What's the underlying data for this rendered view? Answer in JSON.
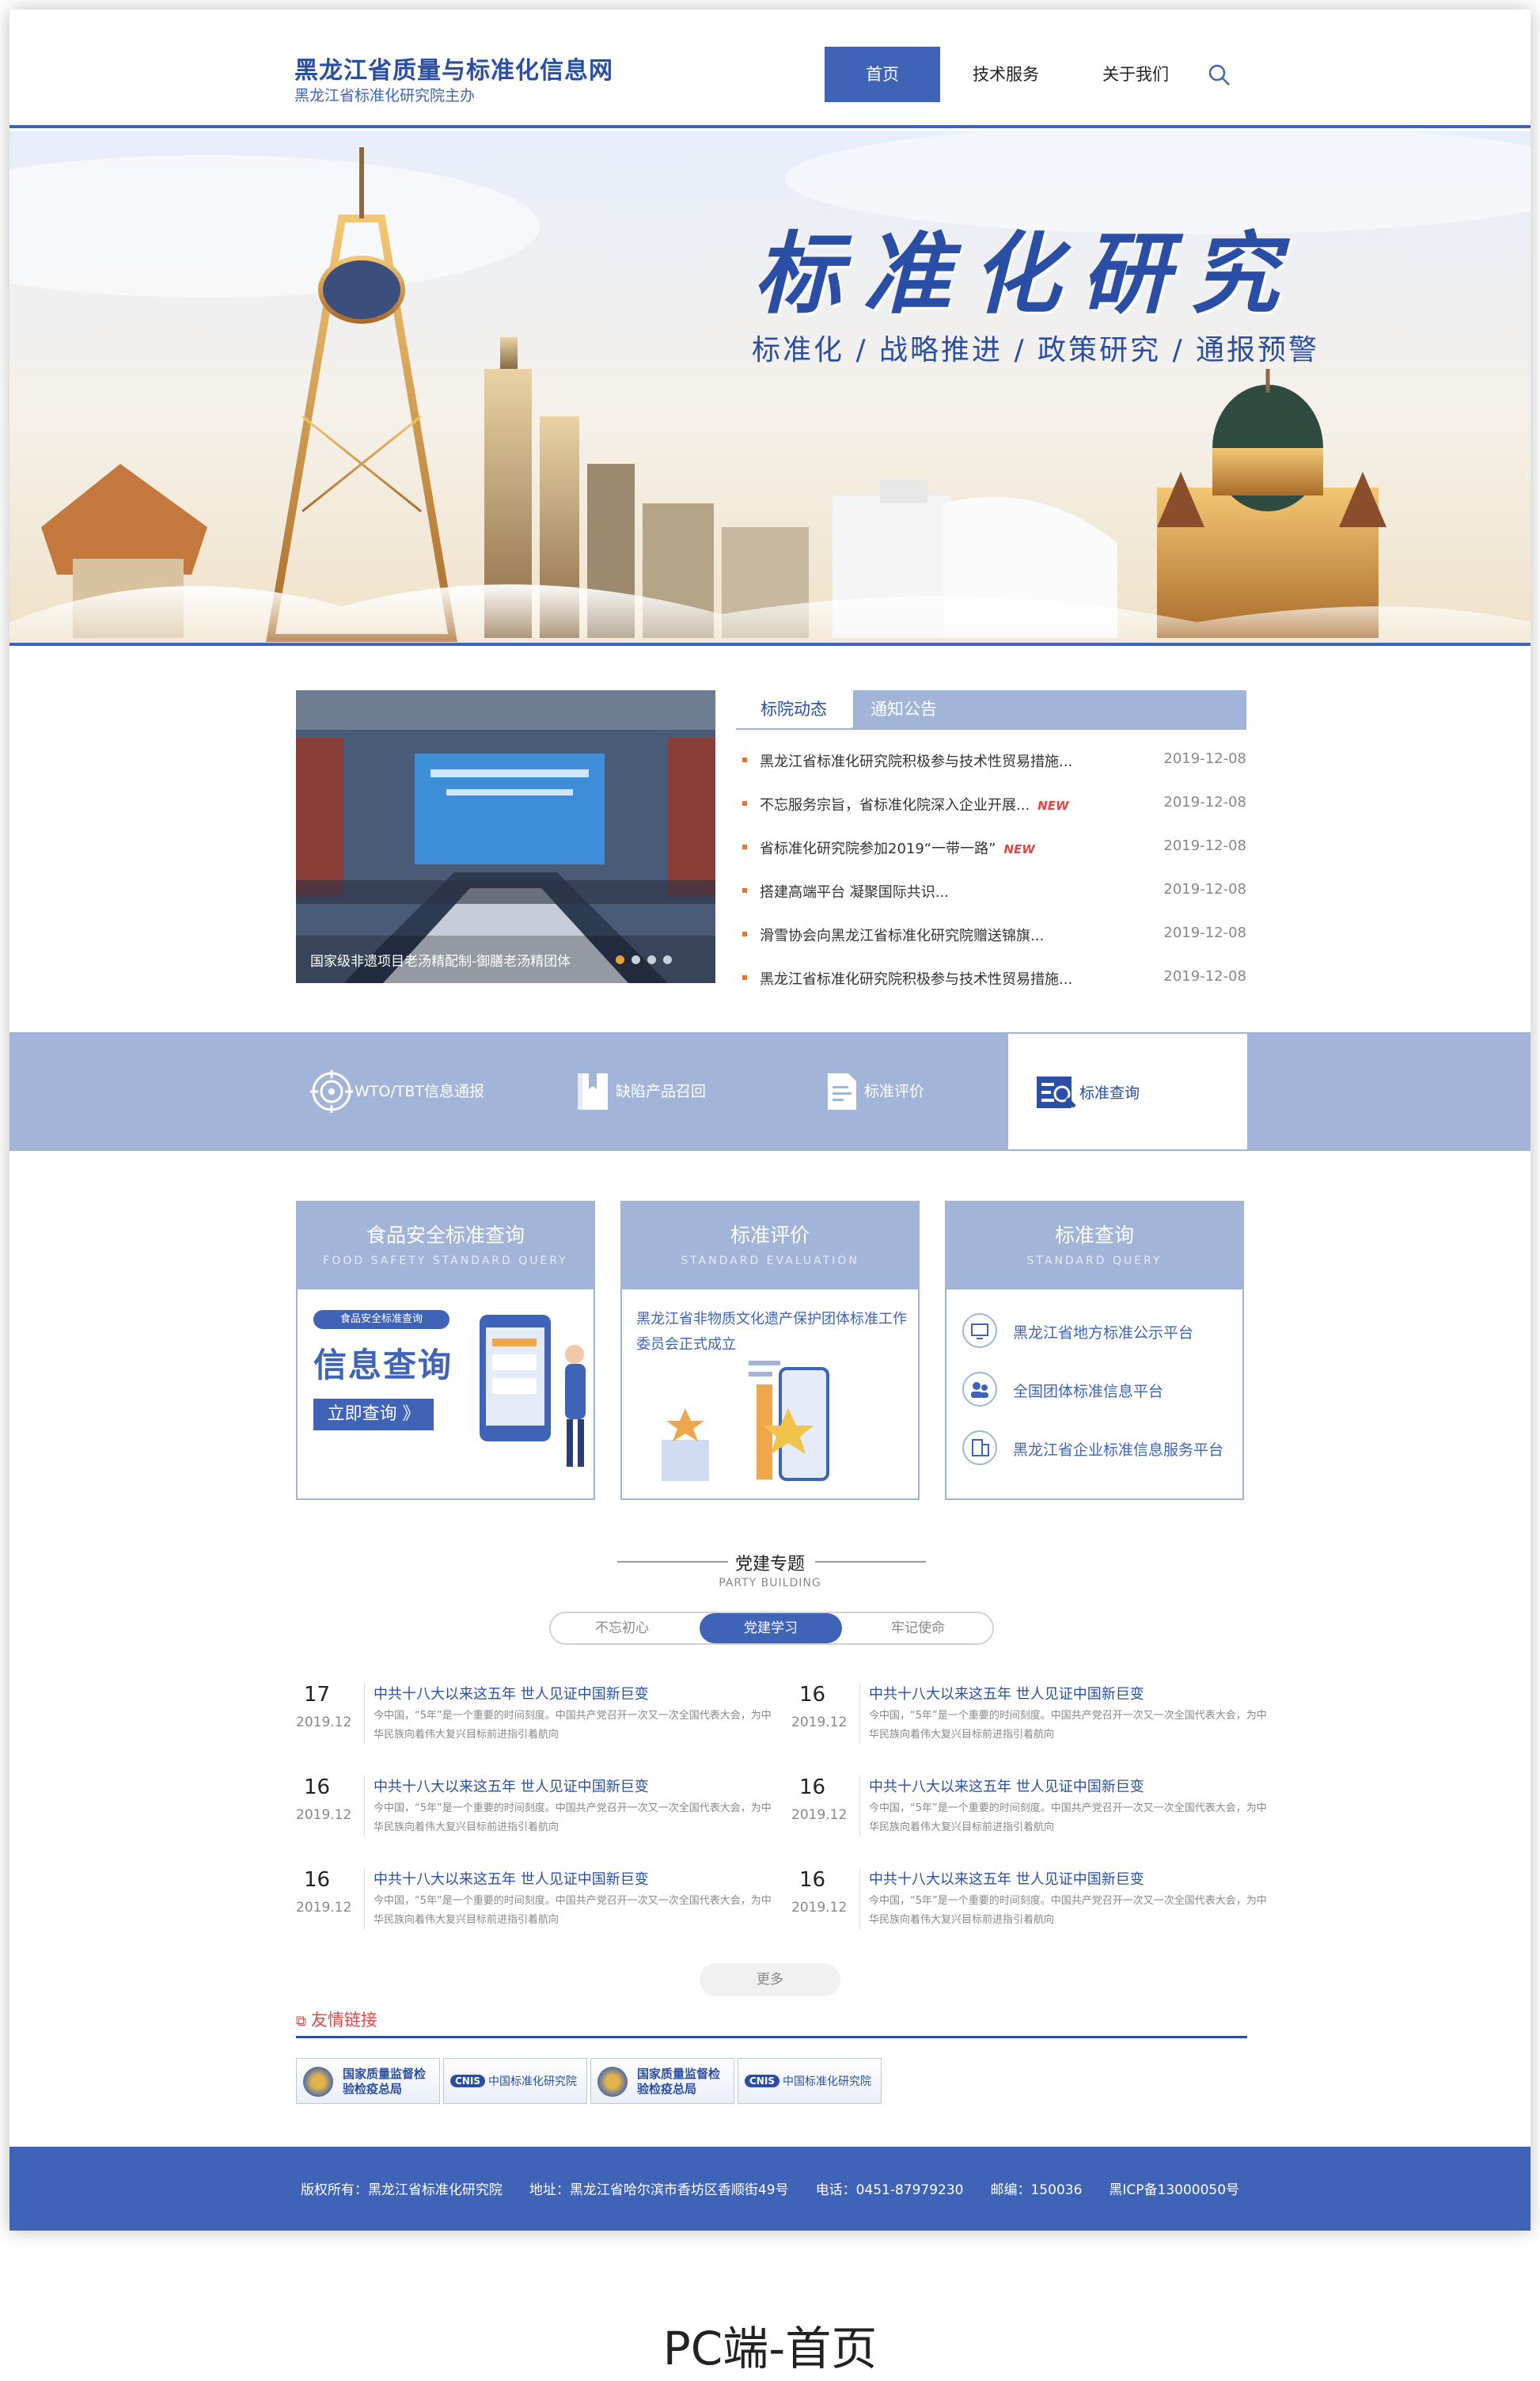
{
  "header": {
    "site_title": "黑龙江省质量与标准化信息网",
    "site_subtitle": "黑龙江省标准化研究院主办",
    "nav": [
      "首页",
      "技术服务",
      "关于我们"
    ],
    "search_icon": "search-icon"
  },
  "banner": {
    "title": "标准化研究",
    "subtitle": "标准化 / 战略推进 / 政策研究 / 通报预警"
  },
  "news": {
    "image_caption": "国家级非遗项目老汤精配制-御膳老汤精团体",
    "tabs": [
      "标院动态",
      "通知公告"
    ],
    "new_badge": "NEW",
    "items": [
      {
        "title": "黑龙江省标准化研究院积极参与技术性贸易措施...",
        "date": "2019-12-08",
        "is_new": false
      },
      {
        "title": "不忘服务宗旨，省标准化院深入企业开展...",
        "date": "2019-12-08",
        "is_new": true
      },
      {
        "title": "省标准化研究院参加2019“一带一路”",
        "date": "2019-12-08",
        "is_new": true
      },
      {
        "title": "搭建高端平台 凝聚国际共识...",
        "date": "2019-12-08",
        "is_new": false
      },
      {
        "title": "滑雪协会向黑龙江省标准化研究院赠送锦旗...",
        "date": "2019-12-08",
        "is_new": false
      },
      {
        "title": "黑龙江省标准化研究院积极参与技术性贸易措施...",
        "date": "2019-12-08",
        "is_new": false
      }
    ]
  },
  "services": [
    {
      "label": "WTO/TBT信息通报",
      "icon": "target-icon"
    },
    {
      "label": "缺陷产品召回",
      "icon": "bookmark-book-icon"
    },
    {
      "label": "标准评价",
      "icon": "document-edit-icon"
    },
    {
      "label": "标准查询",
      "icon": "document-search-icon"
    }
  ],
  "cards": {
    "food": {
      "title": "食品安全标准查询",
      "subtitle": "FOOD SAFETY STANDARD QUERY",
      "tag": "食品安全标准查询",
      "big_text": "信息查询",
      "button": "立即查询 》"
    },
    "evaluation": {
      "title": "标准评价",
      "subtitle": "STANDARD EVALUATION",
      "text": "黑龙江省非物质文化遗产保护团体标准工作委员会正式成立"
    },
    "query": {
      "title": "标准查询",
      "subtitle": "STANDARD QUERY",
      "platforms": [
        "黑龙江省地方标准公示平台",
        "全国团体标准信息平台",
        "黑龙江省企业标准信息服务平台"
      ]
    }
  },
  "party": {
    "title": "党建专题",
    "subtitle": "PARTY BUILDING",
    "tabs": [
      "不忘初心",
      "党建学习",
      "牢记使命"
    ],
    "items": [
      {
        "day": "17",
        "month": "2019.12",
        "title": "中共十八大以来这五年 世人见证中国新巨变",
        "desc": "今中国，“5年”是一个重要的时间刻度。中国共产党召开一次又一次全国代表大会，为中华民族向着伟大复兴目标前进指引着航向"
      },
      {
        "day": "16",
        "month": "2019.12",
        "title": "中共十八大以来这五年 世人见证中国新巨变",
        "desc": "今中国，“5年”是一个重要的时间刻度。中国共产党召开一次又一次全国代表大会，为中华民族向着伟大复兴目标前进指引着航向"
      },
      {
        "day": "16",
        "month": "2019.12",
        "title": "中共十八大以来这五年 世人见证中国新巨变",
        "desc": "今中国，“5年”是一个重要的时间刻度。中国共产党召开一次又一次全国代表大会，为中华民族向着伟大复兴目标前进指引着航向"
      },
      {
        "day": "16",
        "month": "2019.12",
        "title": "中共十八大以来这五年 世人见证中国新巨变",
        "desc": "今中国，“5年”是一个重要的时间刻度。中国共产党召开一次又一次全国代表大会，为中华民族向着伟大复兴目标前进指引着航向"
      },
      {
        "day": "16",
        "month": "2019.12",
        "title": "中共十八大以来这五年 世人见证中国新巨变",
        "desc": "今中国，“5年”是一个重要的时间刻度。中国共产党召开一次又一次全国代表大会，为中华民族向着伟大复兴目标前进指引着航向"
      },
      {
        "day": "16",
        "month": "2019.12",
        "title": "中共十八大以来这五年 世人见证中国新巨变",
        "desc": "今中国，“5年”是一个重要的时间刻度。中国共产党召开一次又一次全国代表大会，为中华民族向着伟大复兴目标前进指引着航向"
      }
    ],
    "more": "更多"
  },
  "links": {
    "title": "友情链接",
    "logos": [
      {
        "text": "国家质量监督检验检疫总局",
        "type": "emblem"
      },
      {
        "text": "中国标准化研究院",
        "type": "cnis"
      },
      {
        "text": "国家质量监督检验检疫总局",
        "type": "emblem"
      },
      {
        "text": "中国标准化研究院",
        "type": "cnis"
      }
    ]
  },
  "footer": {
    "text": "版权所有：黑龙江省标准化研究院　　地址：黑龙江省哈尔滨市香坊区香顺街49号　　电话：0451-87979230　　邮编：150036　　黑ICP备13000050号"
  },
  "caption": "PC端-首页",
  "colors": {
    "primary": "#3f63b6",
    "light": "#a3b4d9",
    "accent": "#e8742c",
    "new": "#e64545"
  }
}
